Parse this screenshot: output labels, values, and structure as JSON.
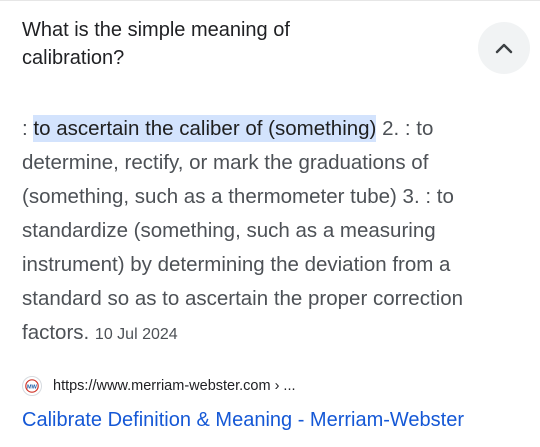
{
  "faq": {
    "question": "What is the simple meaning of calibration?",
    "answer_prefix": ": ",
    "answer_highlight": "to ascertain the caliber of (something)",
    "answer_rest": " 2. : to determine, rectify, or mark the graduations of (something, such as a thermometer tube) 3. : to standardize (something, such as a measuring instrument) by determining the deviation from a standard so as to ascertain the proper correction factors. ",
    "date": "10 Jul 2024",
    "expand_icon": "chevron-up-icon",
    "source": {
      "favicon_icon": "merriam-webster-favicon-icon",
      "favicon_text": "MW",
      "url": "https://www.merriam-webster.com › ...",
      "link_title": "Calibrate Definition & Meaning - Merriam-Webster"
    }
  },
  "colors": {
    "highlight": "#d3e3fd",
    "link": "#1558d6",
    "body_text": "#4d5156",
    "heading_text": "#202124"
  }
}
